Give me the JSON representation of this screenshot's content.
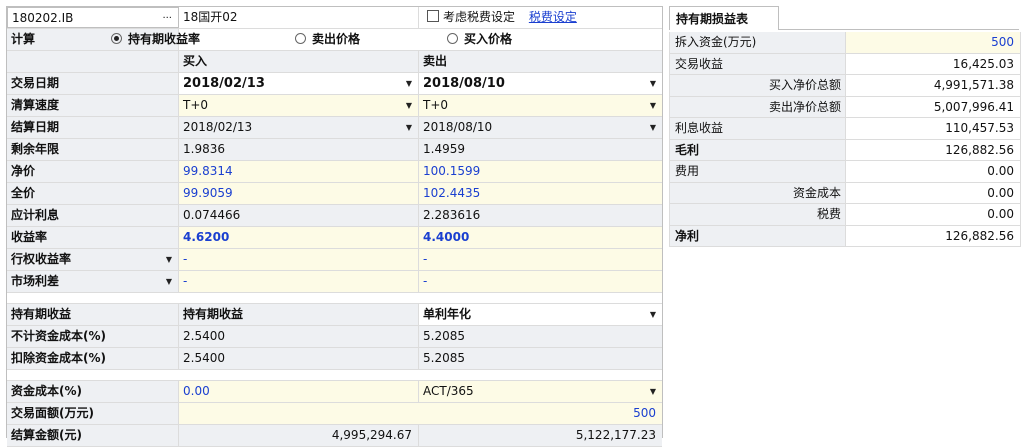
{
  "header": {
    "bond_code": "180202.IB",
    "ellipsis": "···",
    "bond_name": "18国开02",
    "consider_tax_label": "考虑税费设定",
    "tax_settings_link": "税费设定"
  },
  "calc": {
    "label": "计算",
    "options": [
      "持有期收益率",
      "卖出价格",
      "买入价格"
    ],
    "selected": "持有期收益率"
  },
  "columns": {
    "buy": "买入",
    "sell": "卖出"
  },
  "rows": [
    {
      "label": "交易日期",
      "buy": "2018/02/13",
      "sell": "2018/08/10"
    },
    {
      "label": "清算速度",
      "buy": "T+0",
      "sell": "T+0"
    },
    {
      "label": "结算日期",
      "buy": "2018/02/13",
      "sell": "2018/08/10"
    },
    {
      "label": "剩余年限",
      "buy": "1.9836",
      "sell": "1.4959"
    },
    {
      "label": "净价",
      "buy": "99.8314",
      "sell": "100.1599"
    },
    {
      "label": "全价",
      "buy": "99.9059",
      "sell": "102.4435"
    },
    {
      "label": "应计利息",
      "buy": "0.074466",
      "sell": "2.283616"
    },
    {
      "label": "收益率",
      "buy": "4.6200",
      "sell": "4.4000"
    },
    {
      "label": "行权收益率",
      "buy": "-",
      "sell": "-"
    },
    {
      "label": "市场利差",
      "buy": "-",
      "sell": "-"
    }
  ],
  "holding": {
    "label": "持有期收益",
    "col_buy": "持有期收益",
    "col_sell": "单利年化",
    "rows": [
      {
        "label": "不计资金成本(%)",
        "buy": "2.5400",
        "sell": "5.2085"
      },
      {
        "label": "扣除资金成本(%)",
        "buy": "2.5400",
        "sell": "5.2085"
      }
    ]
  },
  "funding": {
    "cost_label": "资金成本(%)",
    "cost_value": "0.00",
    "day_count": "ACT/365",
    "face_label": "交易面额(万元)",
    "face_value": "500",
    "settle_label": "结算金额(元)",
    "settle_buy": "4,995,294.67",
    "settle_sell": "5,122,177.23"
  },
  "pnl": {
    "tab": "持有期损益表",
    "rows": [
      {
        "label": "拆入资金(万元)",
        "value": "500"
      },
      {
        "label": "交易收益",
        "value": "16,425.03"
      },
      {
        "label": "买入净价总额",
        "value": "4,991,571.38"
      },
      {
        "label": "卖出净价总额",
        "value": "5,007,996.41"
      },
      {
        "label": "利息收益",
        "value": "110,457.53"
      },
      {
        "label": "毛利",
        "value": "126,882.56"
      },
      {
        "label": "费用",
        "value": "0.00"
      },
      {
        "label": "资金成本",
        "value": "0.00"
      },
      {
        "label": "税费",
        "value": "0.00"
      },
      {
        "label": "净利",
        "value": "126,882.56"
      }
    ]
  }
}
